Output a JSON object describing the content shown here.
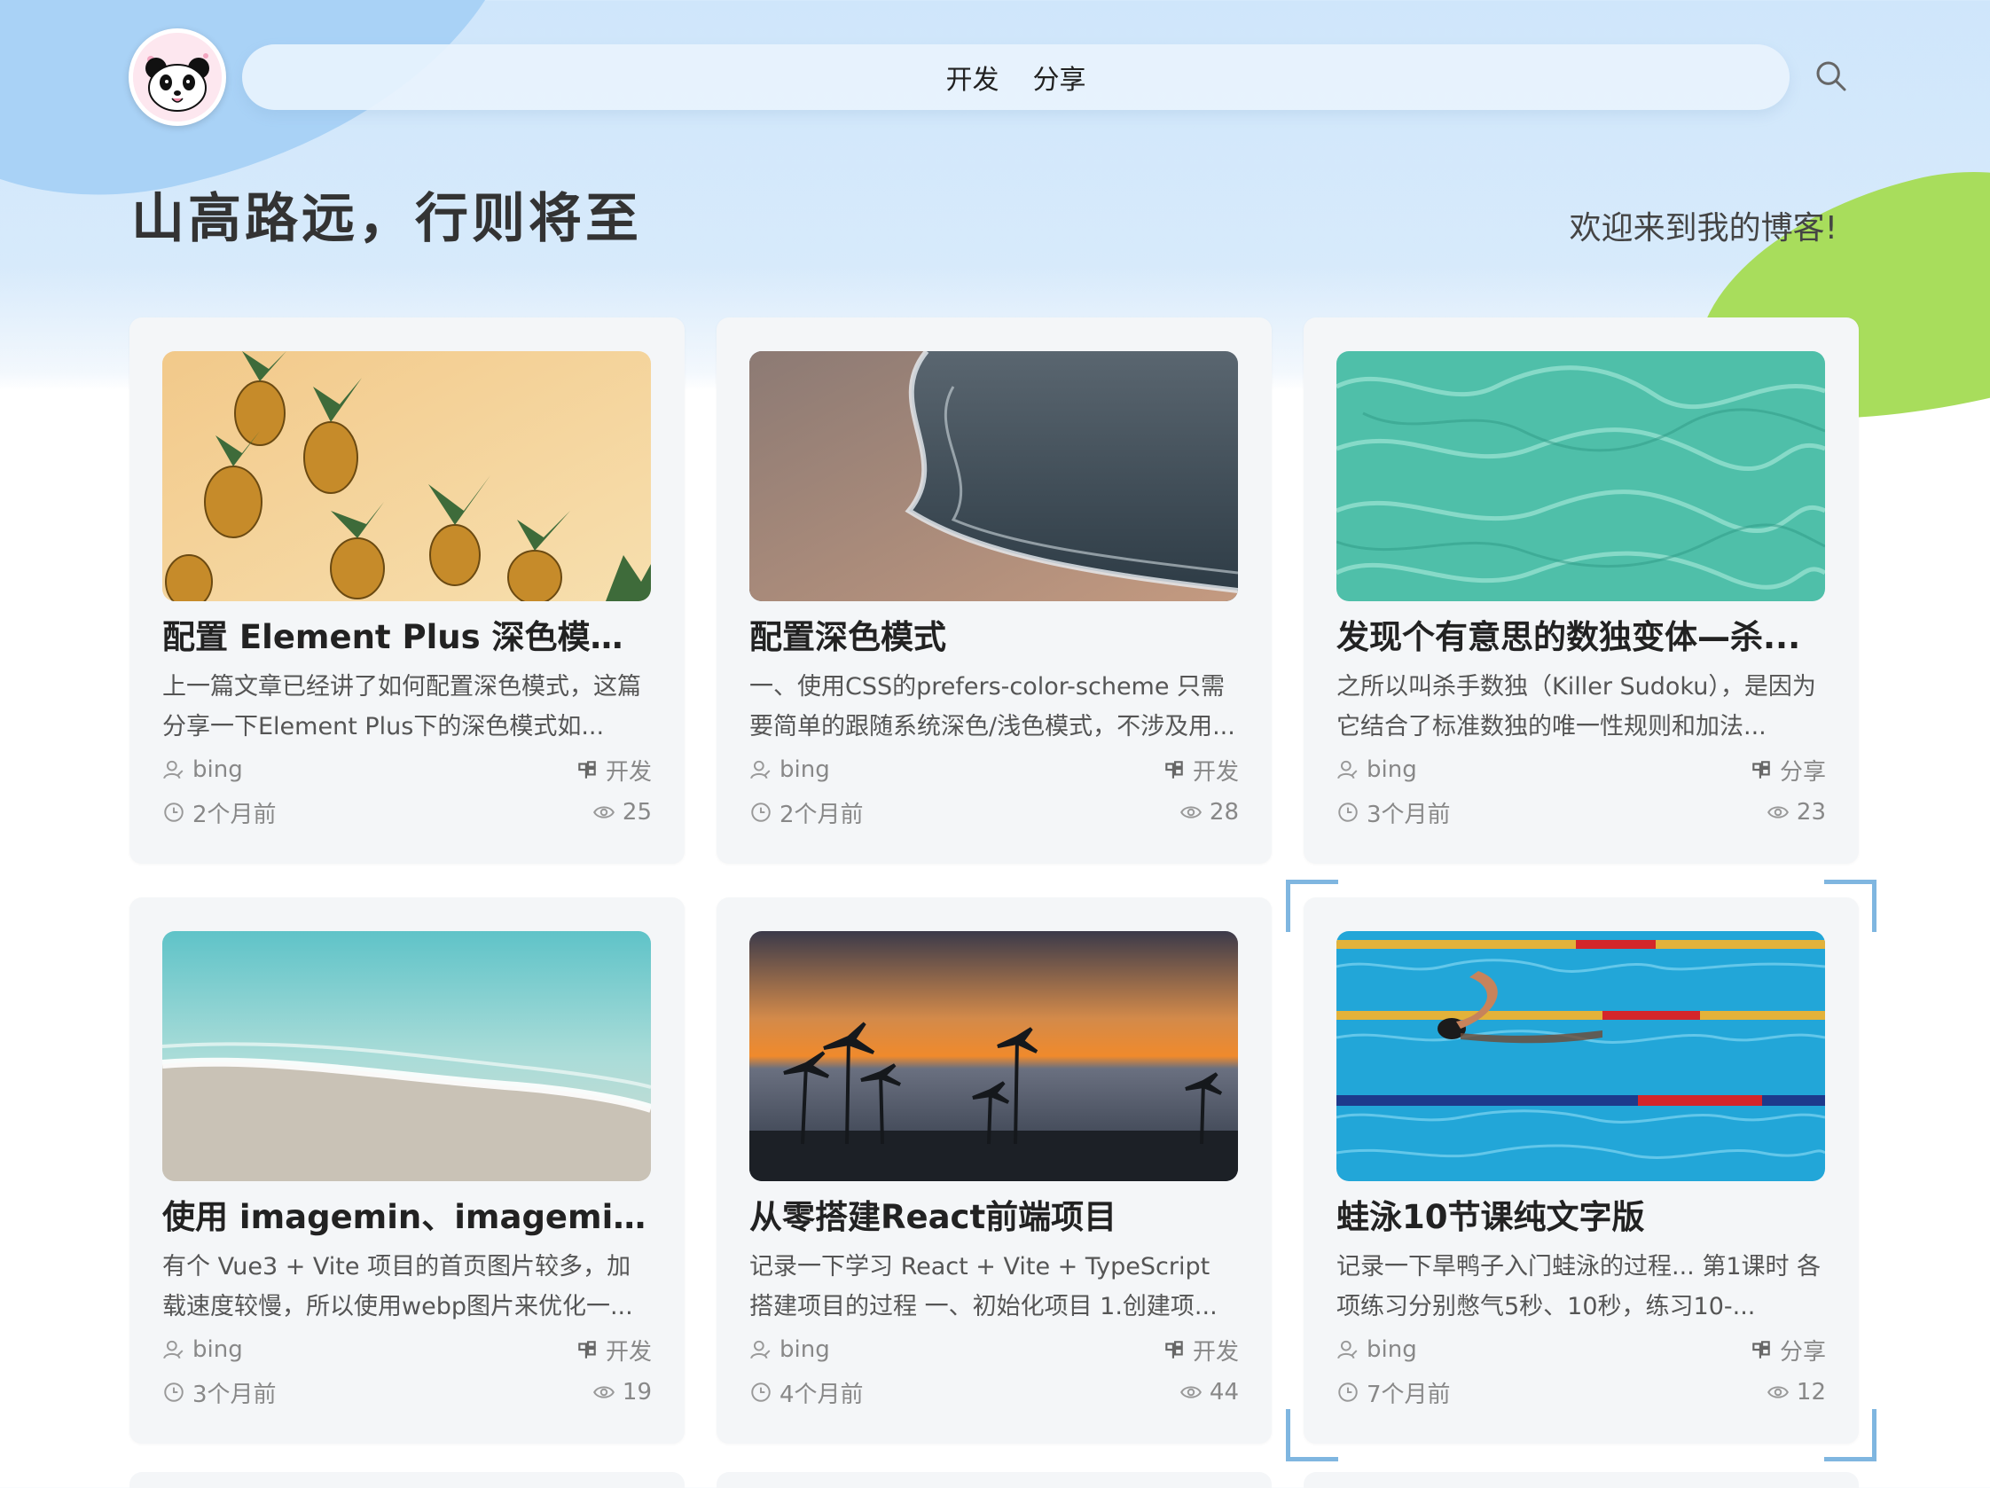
{
  "header": {
    "nav": [
      {
        "label": "开发"
      },
      {
        "label": "分享"
      }
    ]
  },
  "hero": {
    "title": "山高路远，行则将至",
    "welcome": "欢迎来到我的博客!"
  },
  "posts": [
    {
      "title": "配置 Element Plus 深色模式以...",
      "excerpt": "上一篇文章已经讲了如何配置深色模式，这篇分享一下Element Plus下的深色模式如...",
      "author": "bing",
      "category": "开发",
      "time": "2个月前",
      "views": "25",
      "image": "pineapples"
    },
    {
      "title": "配置深色模式",
      "excerpt": "一、使用CSS的prefers-color-scheme 只需要简单的跟随系统深色/浅色模式，不涉及用...",
      "author": "bing",
      "category": "开发",
      "time": "2个月前",
      "views": "28",
      "image": "beach-waves"
    },
    {
      "title": "发现个有意思的数独变体—杀...",
      "excerpt": "之所以叫杀手数独（Killer Sudoku），是因为它结合了标准数独的唯一性规则和加法...",
      "author": "bing",
      "category": "分享",
      "time": "3个月前",
      "views": "23",
      "image": "turquoise-water"
    },
    {
      "title": "使用 imagemin、imagemin-...",
      "excerpt": "有个 Vue3 + Vite 项目的首页图片较多，加载速度较慢，所以使用webp图片来优化一...",
      "author": "bing",
      "category": "开发",
      "time": "3个月前",
      "views": "19",
      "image": "shore-sand"
    },
    {
      "title": "从零搭建React前端项目",
      "excerpt": "记录一下学习 React + Vite + TypeScript 搭建项目的过程 一、初始化项目 1.创建项...",
      "author": "bing",
      "category": "开发",
      "time": "4个月前",
      "views": "44",
      "image": "sunset-palms"
    },
    {
      "title": "蛙泳10节课纯文字版",
      "excerpt": "记录一下旱鸭子入门蛙泳的过程... 第1课时 各项练习分别憋气5秒、10秒，练习10-...",
      "author": "bing",
      "category": "分享",
      "time": "7个月前",
      "views": "12",
      "image": "swimming-pool"
    }
  ],
  "icons": {
    "search": "search-icon",
    "author": "user-icon",
    "category": "category-icon",
    "time": "clock-icon",
    "views": "eye-icon"
  },
  "colors": {
    "sky": "#cfe6fb",
    "blob_blue": "#a9d2f6",
    "blob_green": "#a8dd5c",
    "card_bg": "#f4f6f8",
    "selection": "#7fb6e0"
  }
}
